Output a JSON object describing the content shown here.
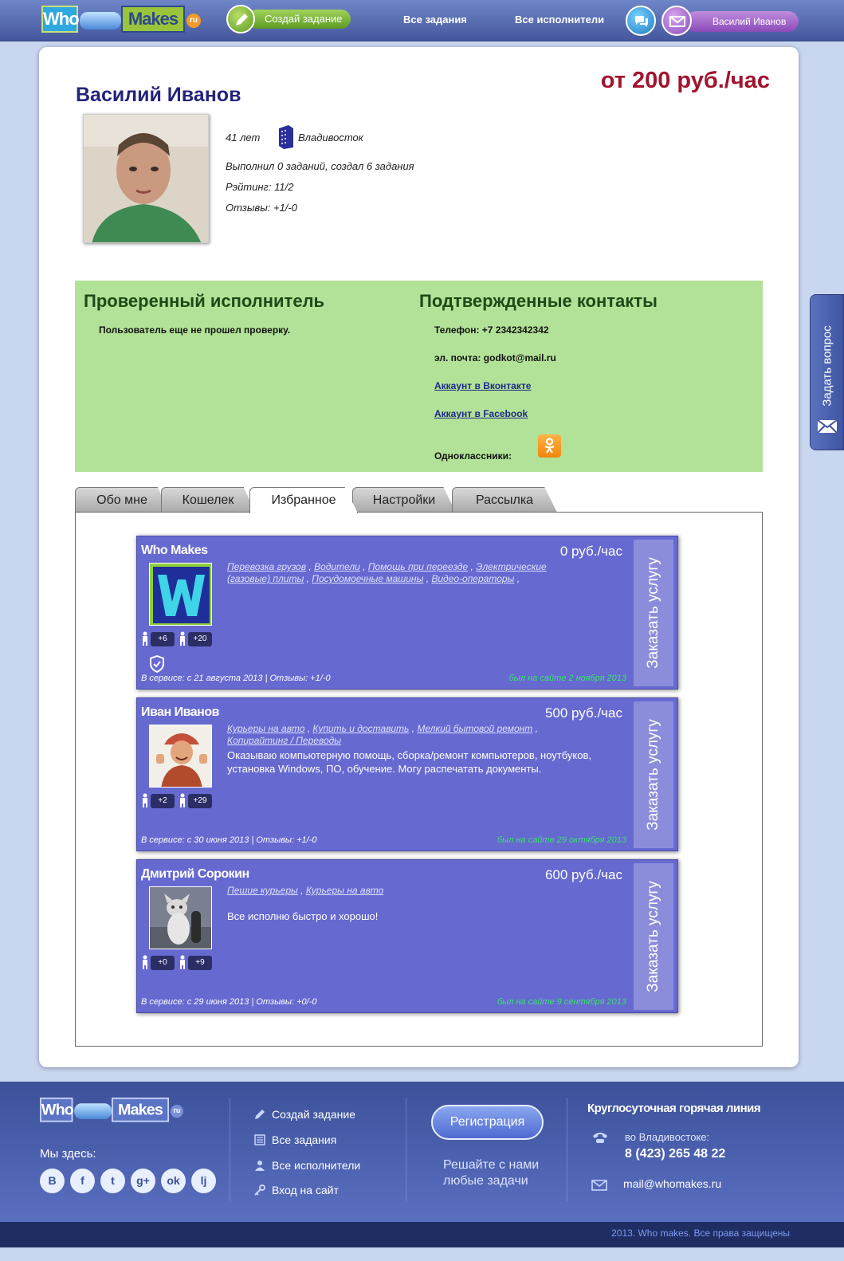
{
  "header": {
    "logo": {
      "who": "Who",
      "makes": "Makes",
      "ru": "ru"
    },
    "create_task": "Создай задание",
    "nav": [
      "Все задания",
      "Все исполнители"
    ],
    "user_name": "Василий Иванов"
  },
  "profile": {
    "name": "Василий Иванов",
    "rate": "от 200 руб./час",
    "age": "41 лет",
    "city": "Владивосток",
    "tasks": "Выполнил 0 заданий, создал 6 задания",
    "rating": "Рэйтинг: 11/2",
    "reviews": "Отзывы: +1/-0"
  },
  "verified": {
    "title": "Проверенный исполнитель",
    "status": "Пользователь еще не прошел проверку."
  },
  "contacts": {
    "title": "Подтвержденные контакты",
    "phone": "Телефон: +7 2342342342",
    "email": "эл. почта: godkot@mail.ru",
    "vk": "Аккаунт в Вконтакте",
    "facebook": "Аккаунт в Facebook",
    "ok": "Одноклассники:"
  },
  "tabs": [
    "Обо мне",
    "Кошелек",
    "Избранное",
    "Настройки",
    "Рассылка"
  ],
  "active_tab": "Избранное",
  "favorites": [
    {
      "name": "Who Makes",
      "price": "0 руб./час",
      "categories": [
        "Перевозка грузов",
        "Водители",
        "Помощь при переезде",
        "Электрические (газовые) плиты",
        "Посудомоечные машины",
        "Видео-операторы"
      ],
      "description": "",
      "counter_a": "+6",
      "counter_b": "+20",
      "since": "В сервисе: с 21 августа 2013 | Отзывы: +1/-0",
      "online": "был на сайте 2 ноября 2013",
      "order": "Заказать услугу"
    },
    {
      "name": "Иван Иванов",
      "price": "500 руб./час",
      "categories": [
        "Курьеры на авто",
        "Купить и доставить",
        "Мелкий бытовой ремонт",
        "Копирайтинг / Переводы"
      ],
      "description": "Оказываю компьютерную помощь, сборка/ремонт компьютеров, ноутбуков, установка Windows, ПО, обучение. Могу распечатать документы.",
      "counter_a": "+2",
      "counter_b": "+29",
      "since": "В сервисе: с 30 июня 2013 | Отзывы: +1/-0",
      "online": "был на сайте 29 октября 2013",
      "order": "Заказать услугу"
    },
    {
      "name": "Дмитрий Сорокин",
      "price": "600 руб./час",
      "categories": [
        "Пешие курьеры",
        "Курьеры на авто"
      ],
      "description": "Все исполню быстро и хорошо!",
      "counter_a": "+0",
      "counter_b": "+9",
      "since": "В сервисе: с 29 июня 2013 | Отзывы: +0/-0",
      "online": "был на сайте 9 сентября 2013",
      "order": "Заказать услугу"
    }
  ],
  "ask_question": "Задать вопрос",
  "footer": {
    "here": "Мы здесь:",
    "social": [
      "B",
      "f",
      "t",
      "g+",
      "ok",
      "lj"
    ],
    "links": [
      "Создай задание",
      "Все задания",
      "Все исполнители",
      "Вход на сайт"
    ],
    "register": "Регистрация",
    "solve_1": "Решайте с нами",
    "solve_2": "любые задачи",
    "hotline_title": "Круглосуточная горячая линия",
    "city": "во Владивостоке:",
    "phone": "8 (423) 265 48 22",
    "email": "mail@whomakes.ru",
    "copyright": "2013. Who makes. Все права защищены"
  }
}
